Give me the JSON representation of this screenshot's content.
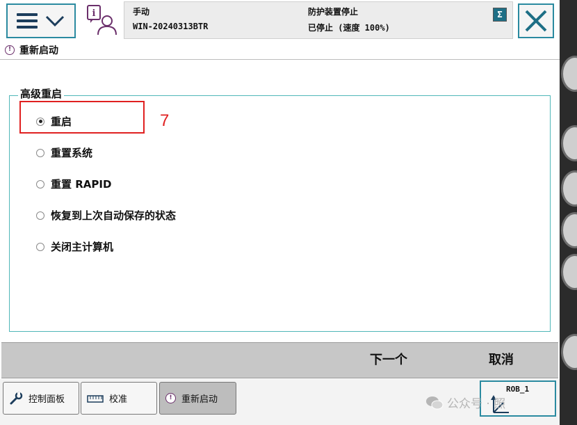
{
  "header": {
    "mode": "手动",
    "controller_name": "WIN-20240313BTR",
    "safety_status": "防护装置停止",
    "run_status": "已停止 (速度 100%)"
  },
  "page": {
    "title": "重新启动"
  },
  "restart_group": {
    "legend": "高级重启",
    "options": [
      {
        "label": "重启",
        "selected": true
      },
      {
        "label": "重置系统",
        "selected": false
      },
      {
        "label": "重置 RAPID",
        "selected": false
      },
      {
        "label": "恢复到上次自动保存的状态",
        "selected": false
      },
      {
        "label": "关闭主计算机",
        "selected": false
      }
    ]
  },
  "annotation": {
    "step_number": "7",
    "color": "#e02020"
  },
  "command_bar": {
    "next_label": "下一个",
    "cancel_label": "取消"
  },
  "taskbar": {
    "tabs": [
      {
        "label": "控制面板",
        "icon": "wrench-icon"
      },
      {
        "label": "校准",
        "icon": "ruler-icon"
      },
      {
        "label": "重新启动",
        "icon": "restart-icon",
        "active": true
      }
    ],
    "rob_label": "ROB_1"
  },
  "watermark": {
    "text": "公众号 · 照"
  },
  "colors": {
    "accent": "#2a8aa0",
    "group_border": "#4fb6b8",
    "command_bar": "#c7c7c7",
    "highlight": "#e02020"
  }
}
